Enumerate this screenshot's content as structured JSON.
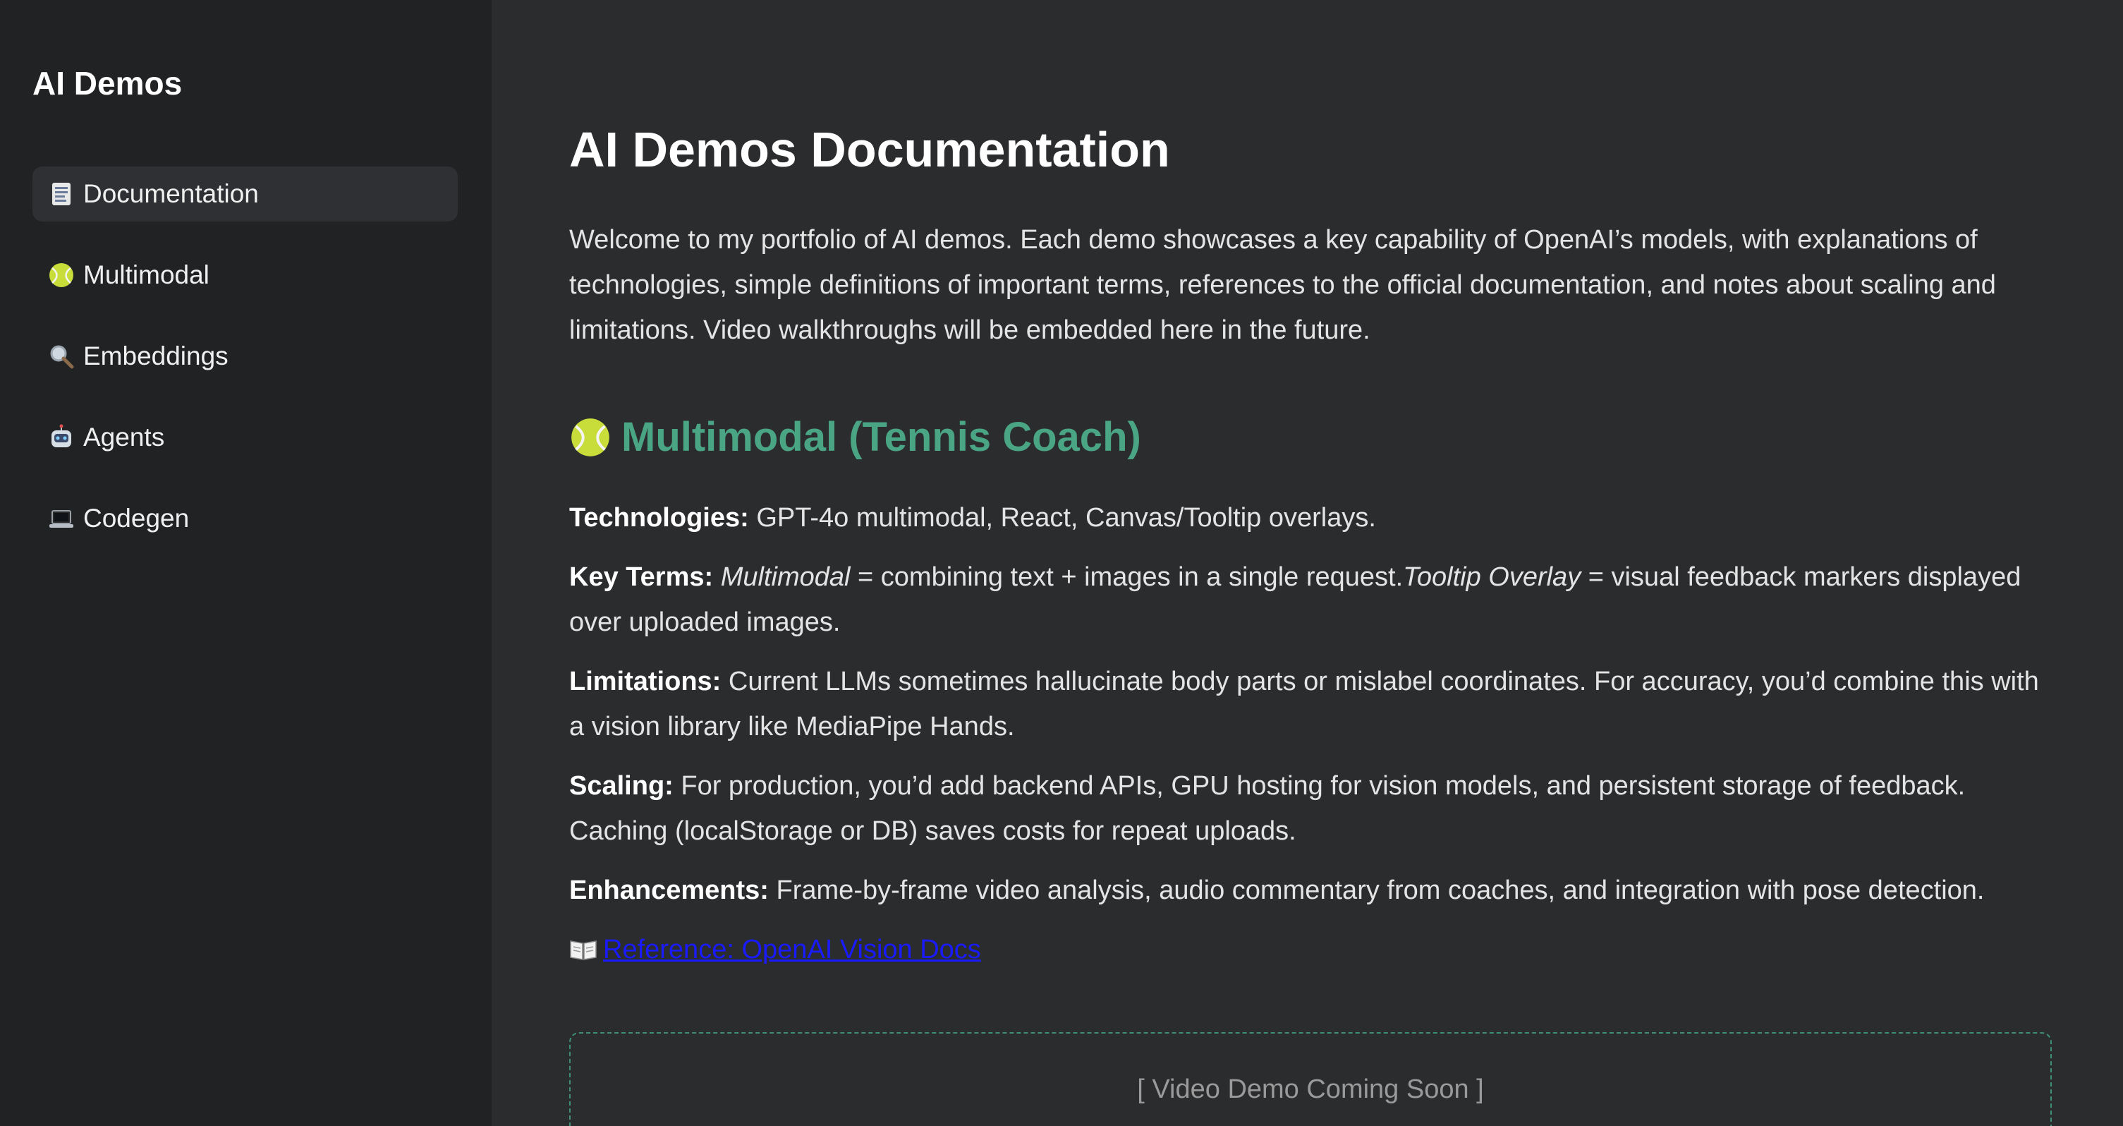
{
  "sidebar": {
    "title": "AI Demos",
    "items": [
      {
        "label": "Documentation",
        "icon": "page-icon",
        "active": true
      },
      {
        "label": "Multimodal",
        "icon": "tennis-ball-icon",
        "active": false
      },
      {
        "label": "Embeddings",
        "icon": "magnifier-icon",
        "active": false
      },
      {
        "label": "Agents",
        "icon": "robot-icon",
        "active": false
      },
      {
        "label": "Codegen",
        "icon": "laptop-icon",
        "active": false
      }
    ]
  },
  "main": {
    "title": "AI Demos Documentation",
    "intro": "Welcome to my portfolio of AI demos. Each demo showcases a key capability of OpenAI’s models, with explanations of technologies, simple definitions of important terms, references to the official documentation, and notes about scaling and limitations. Video walkthroughs will be embedded here in the future.",
    "section": {
      "heading": "Multimodal (Tennis Coach)",
      "heading_icon": "tennis-ball-icon",
      "heading_color": "#4aa585",
      "technologies_label": "Technologies:",
      "technologies_text": " GPT-4o multimodal, React, Canvas/Tooltip overlays.",
      "key_terms_label": "Key Terms:",
      "key_terms_term1": "Multimodal",
      "key_terms_def1": " = combining text + images in a single request.",
      "key_terms_term2": "Tooltip Overlay",
      "key_terms_def2": " = visual feedback markers displayed over uploaded images.",
      "limitations_label": "Limitations:",
      "limitations_text": " Current LLMs sometimes hallucinate body parts or mislabel coordinates. For accuracy, you’d combine this with a vision library like MediaPipe Hands.",
      "scaling_label": "Scaling:",
      "scaling_text": " For production, you’d add backend APIs, GPU hosting for vision models, and persistent storage of feedback. Caching (localStorage or DB) saves costs for repeat uploads.",
      "enhancements_label": "Enhancements:",
      "enhancements_text": " Frame-by-frame video analysis, audio commentary from coaches, and integration with pose detection.",
      "reference_link": "Reference: OpenAI Vision Docs",
      "reference_icon": "book-icon",
      "link_color": "#1a1aff",
      "video_placeholder": "[ Video Demo Coming Soon ]"
    }
  }
}
